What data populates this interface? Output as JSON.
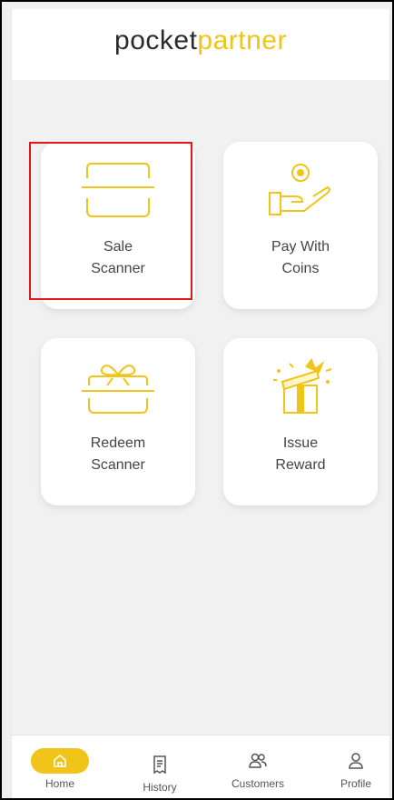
{
  "app": {
    "logo_part1": "pocket",
    "logo_part2": "partner"
  },
  "colors": {
    "accent": "#f0c419",
    "background": "#f1f1f1",
    "highlight": "#e01818"
  },
  "cards": [
    {
      "label": "Sale\nScanner",
      "icon": "scanner-icon"
    },
    {
      "label": "Pay With\nCoins",
      "icon": "hand-coin-icon"
    },
    {
      "label": "Redeem\nScanner",
      "icon": "gift-scanner-icon"
    },
    {
      "label": "Issue\nReward",
      "icon": "gift-box-icon"
    }
  ],
  "tabs": [
    {
      "label": "Home",
      "icon": "home-icon",
      "active": true
    },
    {
      "label": "History",
      "icon": "history-icon",
      "active": false
    },
    {
      "label": "Customers",
      "icon": "customers-icon",
      "active": false
    },
    {
      "label": "Profile",
      "icon": "profile-icon",
      "active": false
    }
  ]
}
